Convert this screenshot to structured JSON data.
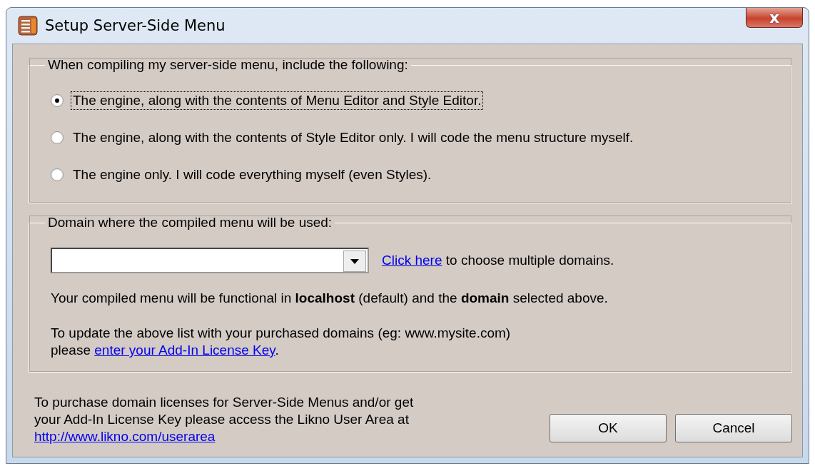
{
  "window": {
    "title": "Setup Server-Side Menu",
    "close": "x"
  },
  "include_group": {
    "legend": "When compiling my server-side menu, include the following:",
    "options": [
      {
        "label": "The engine, along with the contents of Menu Editor and Style Editor.",
        "selected": true
      },
      {
        "label": "The engine, along with the contents of Style Editor only. I will code the menu structure myself.",
        "selected": false
      },
      {
        "label": "The engine only. I will code everything myself (even Styles).",
        "selected": false
      }
    ]
  },
  "domain_group": {
    "legend": "Domain where the compiled menu will be used:",
    "multi_hint": {
      "link": "Click here",
      "text": "to choose multiple domains."
    },
    "functional_note": "Your compiled menu will be functional in **localhost** (default) and the **domain** selected above.",
    "update_note": {
      "text": "To update the above list with your purchased domains (eg: www.mysite.com) please",
      "link": "enter your Add-In License Key",
      "after": "."
    }
  },
  "footer": {
    "lines": [
      "To purchase domain licenses for Server-Side Menus and/or get",
      "your Add-In License Key please access the Likno User Area at"
    ],
    "link": "http://www.likno.com/userarea"
  },
  "buttons": [
    "OK",
    "Cancel"
  ]
}
